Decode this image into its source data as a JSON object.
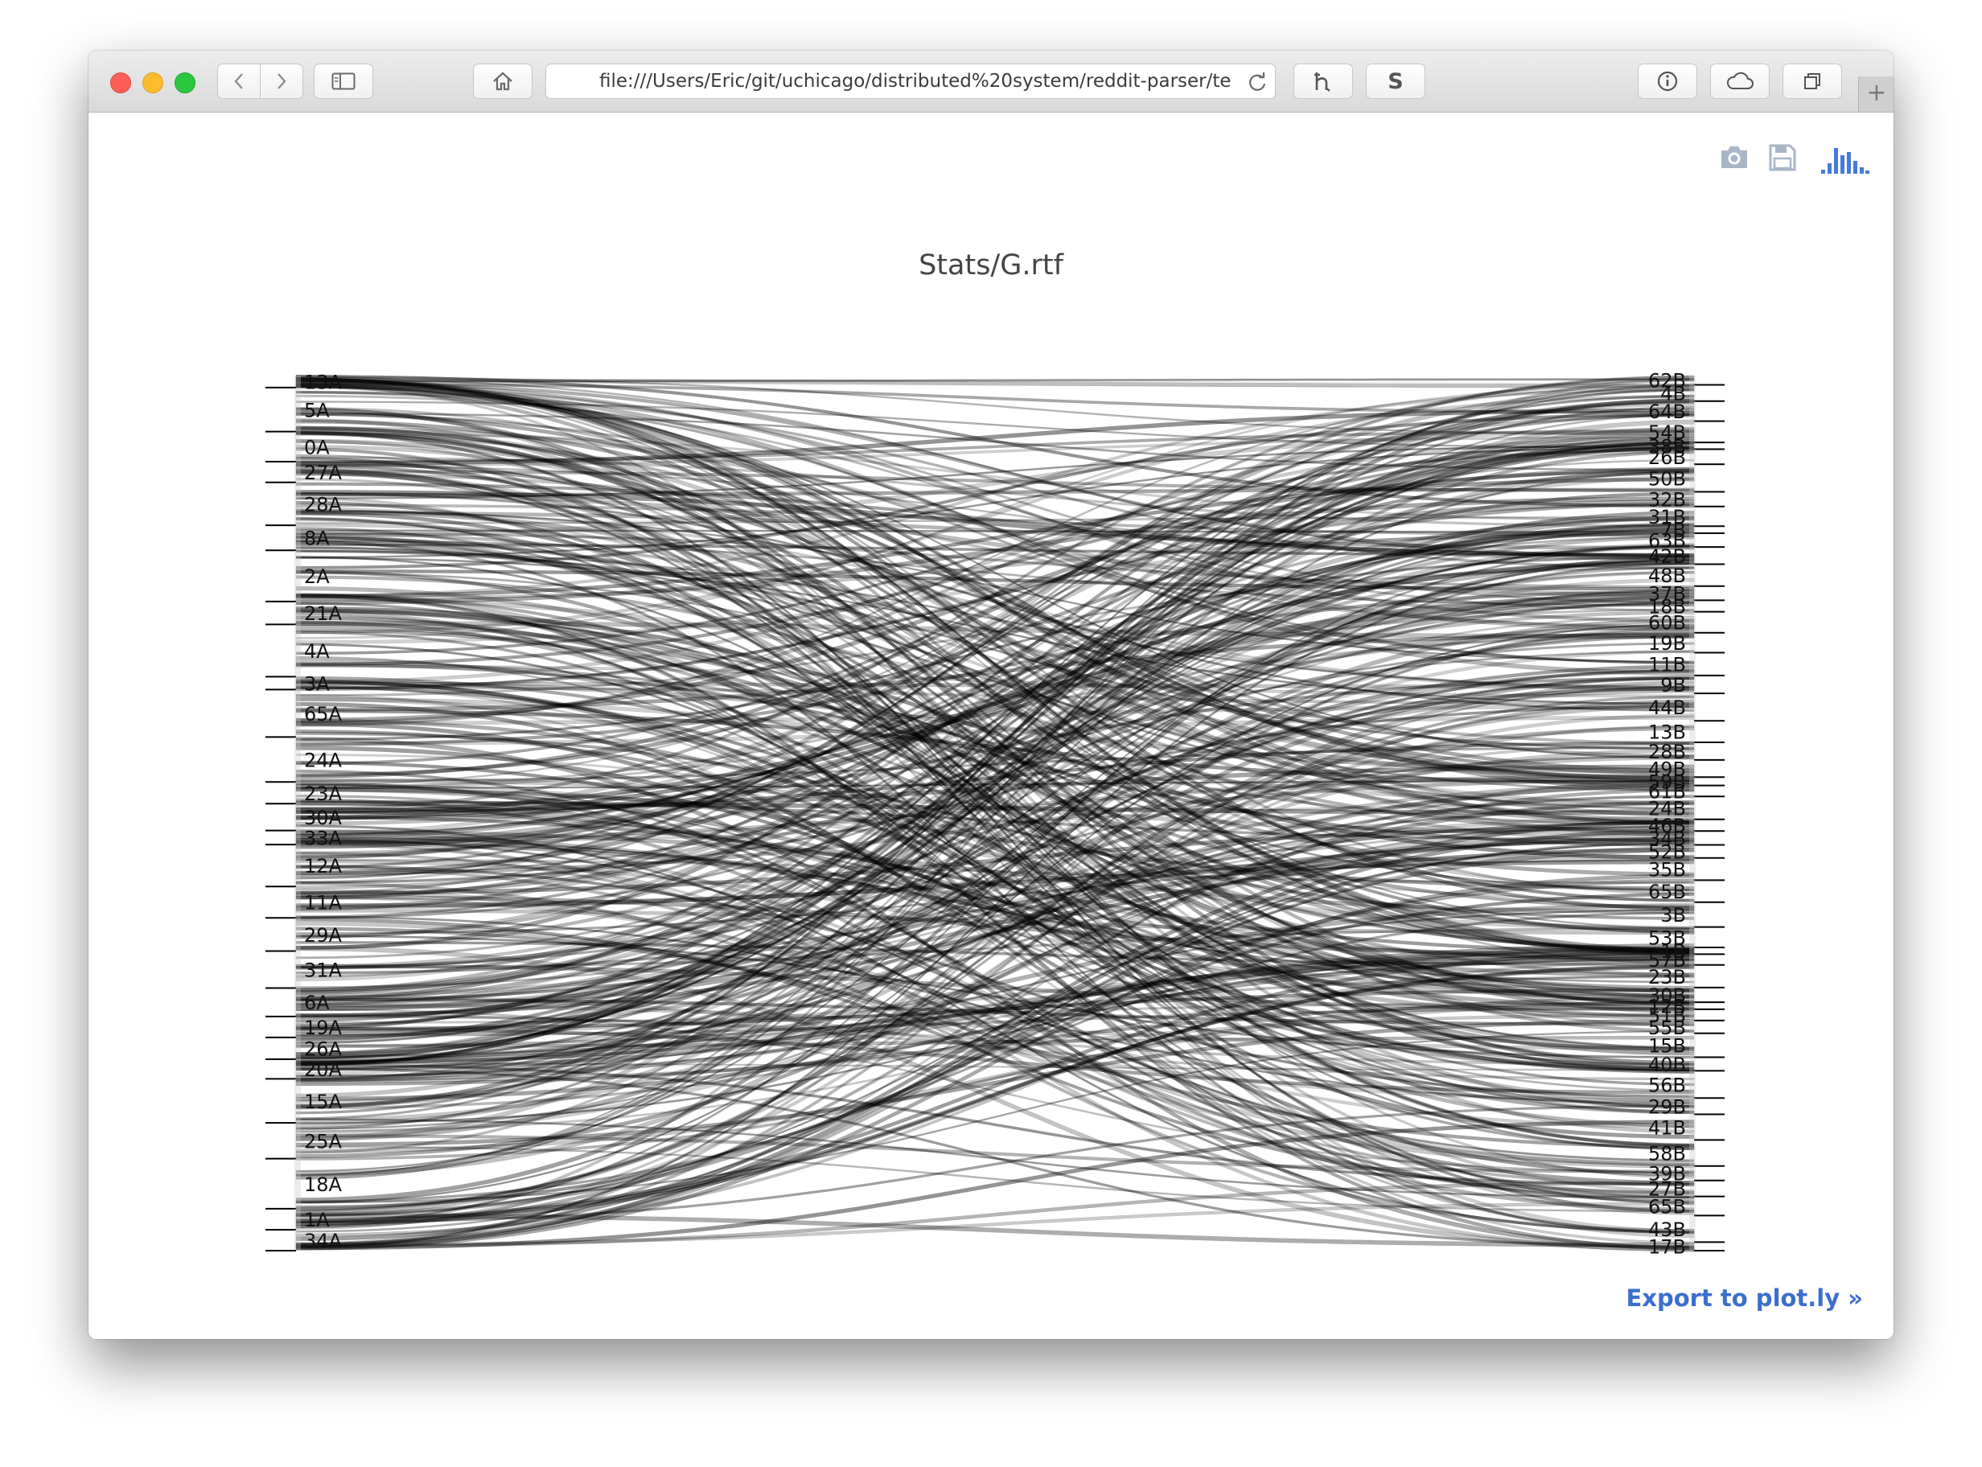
{
  "browser": {
    "url": "file:///Users/Eric/git/uchicago/distributed%20system/reddit-parser/te",
    "shortcut_s_label": "S",
    "new_tab_label": "+"
  },
  "modebar": {
    "icons": [
      "camera-icon",
      "floppy-disk-icon",
      "plotly-logo-icon"
    ]
  },
  "export_link": "Export to plot.ly »",
  "chart_data": {
    "type": "parallel-categories",
    "title": "Stats/G.rtf",
    "left_dimension": {
      "categories": [
        "13A",
        "5A",
        "0A",
        "27A",
        "28A",
        "8A",
        "2A",
        "21A",
        "4A",
        "3A",
        "65A",
        "24A",
        "23A",
        "30A",
        "33A",
        "12A",
        "11A",
        "29A",
        "31A",
        "6A",
        "19A",
        "26A",
        "20A",
        "15A",
        "25A",
        "18A",
        "1A",
        "34A"
      ]
    },
    "right_dimension": {
      "categories": [
        "62B",
        "4B",
        "64B",
        "54B",
        "38B",
        "26B",
        "50B",
        "32B",
        "31B",
        "7B",
        "63B",
        "42B",
        "48B",
        "37B",
        "18B",
        "60B",
        "19B",
        "11B",
        "9B",
        "44B",
        "13B",
        "28B",
        "49B",
        "59B",
        "61B",
        "24B",
        "46B",
        "34B",
        "52B",
        "35B",
        "65B",
        "3B",
        "53B",
        "1B",
        "57B",
        "23B",
        "30B",
        "12B",
        "51B",
        "55B",
        "15B",
        "40B",
        "56B",
        "29B",
        "41B",
        "58B",
        "39B",
        "27B",
        "65B",
        "43B",
        "17B"
      ]
    }
  }
}
